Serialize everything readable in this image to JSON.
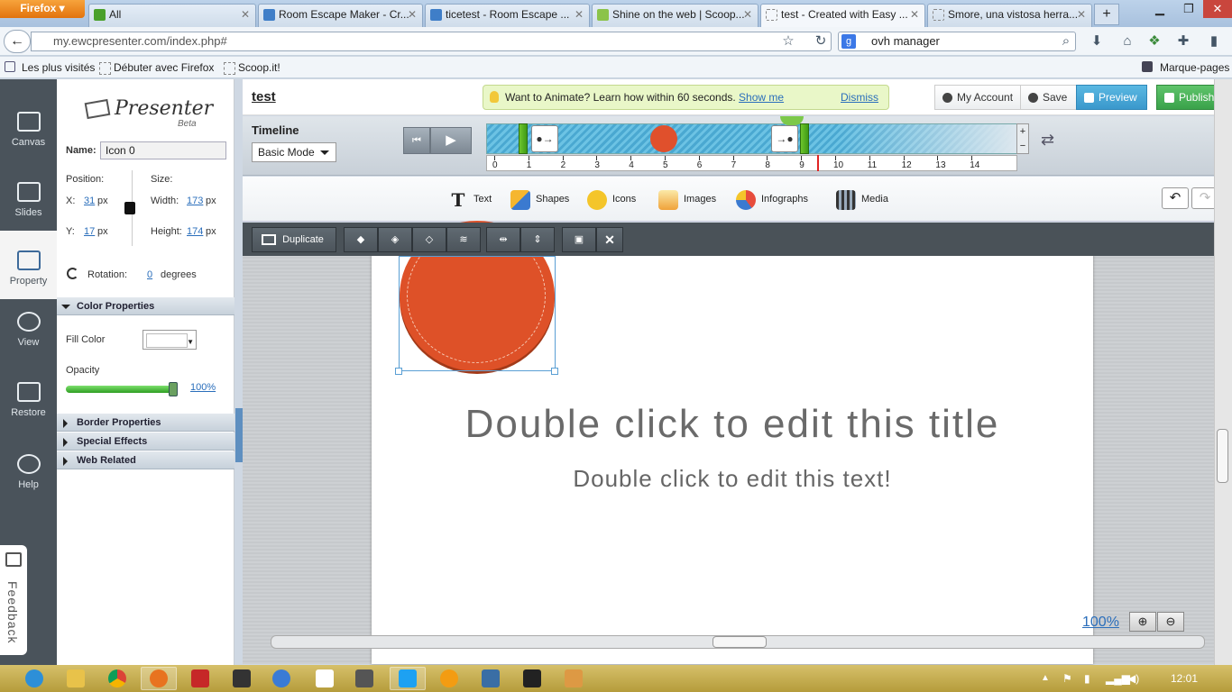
{
  "browser": {
    "menu_label": "Firefox",
    "tabs": [
      {
        "label": "All",
        "color": "#4aa02c"
      },
      {
        "label": "Room Escape Maker - Cr...",
        "color": "#3f7ec8"
      },
      {
        "label": "ticetest - Room Escape ...",
        "color": "#3f7ec8"
      },
      {
        "label": "Shine on the web | Scoop...",
        "color": "#8bc34a"
      },
      {
        "label": "test - Created with Easy ...",
        "color": "#ffffff"
      },
      {
        "label": "Smore, una vistosa herra...",
        "color": "#ffffff"
      }
    ],
    "new_tab": "+",
    "url": "my.ewcpresenter.com/index.php#",
    "search_value": "ovh manager",
    "bookmarks": {
      "most_visited": "Les plus visités",
      "getting_started": "Débuter avec Firefox",
      "scoop": "Scoop.it!",
      "bookmarks_menu": "Marque-pages"
    }
  },
  "rail": {
    "canvas": "Canvas",
    "slides": "Slides",
    "property": "Property",
    "view": "View",
    "restore": "Restore",
    "help": "Help",
    "feedback": "Feedback"
  },
  "logo": {
    "name": "Presenter",
    "badge": "Beta"
  },
  "property": {
    "name_label": "Name:",
    "name_value": "Icon 0",
    "position_label": "Position:",
    "size_label": "Size:",
    "x_label": "X:",
    "x_value": "31",
    "x_unit": "px",
    "y_label": "Y:",
    "y_value": "17",
    "y_unit": "px",
    "width_label": "Width:",
    "width_value": "173",
    "width_unit": "px",
    "height_label": "Height:",
    "height_value": "174",
    "height_unit": "px",
    "rotation_label": "Rotation:",
    "rotation_value": "0",
    "rotation_unit": "degrees",
    "color_section": "Color Properties",
    "fill_label": "Fill Color",
    "opacity_label": "Opacity",
    "opacity_value": "100%",
    "opacity_fraction": 1.0,
    "border_section": "Border Properties",
    "effects_section": "Special Effects",
    "web_section": "Web Related"
  },
  "header": {
    "doc_title": "test",
    "tip_text": "Want to Animate? Learn how within 60 seconds.",
    "tip_link": "Show me",
    "tip_dismiss": "Dismiss",
    "my_account": "My Account",
    "save": "Save",
    "preview": "Preview",
    "publish": "Publish"
  },
  "timeline": {
    "title": "Timeline",
    "mode": "Basic Mode",
    "ruler": [
      "0",
      "1",
      "2",
      "3",
      "4",
      "5",
      "6",
      "7",
      "8",
      "9",
      "10",
      "11",
      "12",
      "13",
      "14"
    ],
    "playhead_time": 9.5,
    "zoom_plus": "+",
    "zoom_minus": "−"
  },
  "insert": {
    "text": "Text",
    "shapes": "Shapes",
    "icons": "Icons",
    "images": "Images",
    "infographs": "Infographs",
    "media": "Media"
  },
  "edit": {
    "duplicate": "Duplicate"
  },
  "slide": {
    "title": "Double click to edit this title",
    "text": "Double click to edit this text!",
    "zoom": "100%",
    "shape_color": "#de5128"
  },
  "taskbar": {
    "clock": "12:01"
  }
}
